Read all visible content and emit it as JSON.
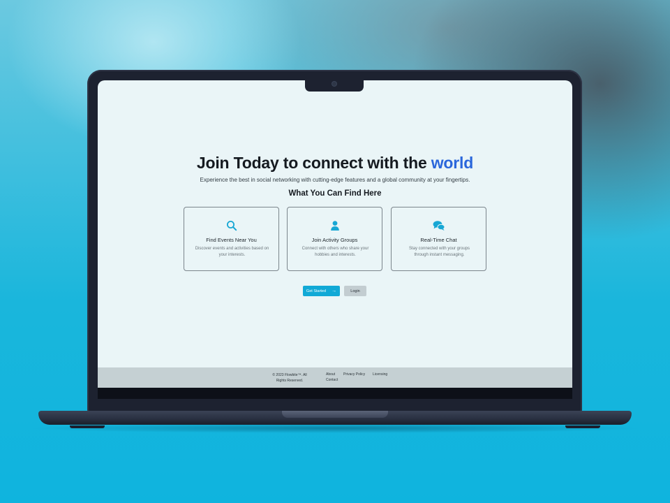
{
  "hero": {
    "title_main": "Join Today to connect with the ",
    "title_accent": "world",
    "subtitle": "Experience the best in social networking with cutting-edge features and a global community at your fingertips.",
    "section_title": "What You Can Find Here"
  },
  "features": [
    {
      "icon": "search-icon",
      "title": "Find Events Near You",
      "description": "Discover events and activities based on your interests."
    },
    {
      "icon": "user-icon",
      "title": "Join Activity Groups",
      "description": "Connect with others who share your hobbies and interests."
    },
    {
      "icon": "chat-icon",
      "title": "Real-Time Chat",
      "description": "Stay connected with your groups through instant messaging."
    }
  ],
  "actions": {
    "get_started_label": "Get Started",
    "login_label": "Login"
  },
  "footer": {
    "copyright": "© 2023 Flowbite™. All Rights Reserved.",
    "links": [
      "About",
      "Privacy Policy",
      "Licensing",
      "Contact"
    ]
  },
  "colors": {
    "accent": "#2a66db",
    "primary_button": "#11a9d6",
    "icon": "#17a7d4"
  }
}
